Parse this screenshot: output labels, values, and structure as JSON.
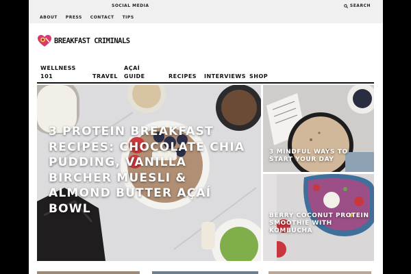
{
  "topbar": {
    "social_label": "SOCIAL MEDIA",
    "links": [
      "ABOUT",
      "PRESS",
      "CONTACT",
      "TIPS"
    ],
    "search_label": "SEARCH"
  },
  "brand": {
    "name": "BREAKFAST CRIMINALS"
  },
  "nav": {
    "items": [
      "WELLNESS 101",
      "TRAVEL",
      "AÇAÍ GUIDE",
      "RECIPES",
      "INTERVIEWS",
      "SHOP"
    ]
  },
  "posts": {
    "featured": {
      "title": "3 PROTEIN BREAKFAST RECIPES: CHOCOLATE CHIA PUDDING, VANILLA BIRCHER MUESLI & ALMOND BUTTER AÇAÍ BOWL"
    },
    "side_top": {
      "title": "3 MINDFUL WAYS TO START YOUR DAY"
    },
    "side_bottom": {
      "title": "BERRY COCONUT PROTEIN SMOOTHIE WITH KOMBUCHA"
    }
  },
  "colors": {
    "page_bg": "#000000",
    "content_bg": "#ffffff",
    "topbar_bg": "#f0f0f0",
    "logo_heart": "#d93a6a",
    "logo_accent": "#f2c94c"
  }
}
